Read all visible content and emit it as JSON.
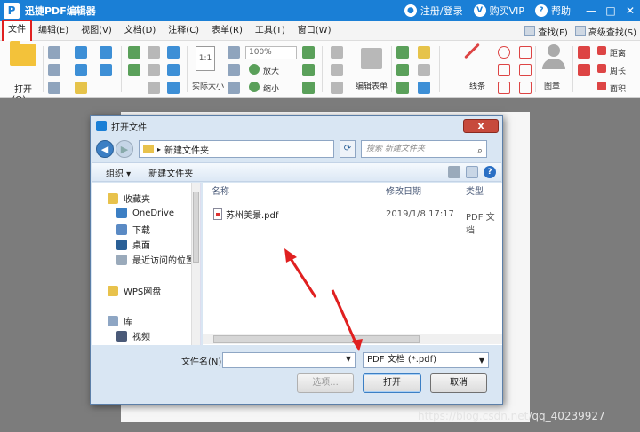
{
  "app": {
    "logo_letter": "P",
    "title": "迅捷PDF编辑器",
    "login": "注册/登录",
    "buy_vip": "购买VIP",
    "help": "帮助",
    "win_min": "—",
    "win_max": "□",
    "win_close": "✕"
  },
  "menu": {
    "items": [
      "文件",
      "编辑(E)",
      "视图(V)",
      "文档(D)",
      "注释(C)",
      "表单(R)",
      "工具(T)",
      "窗口(W)"
    ],
    "find": "查找(F)",
    "advanced_find": "高级查找(S)"
  },
  "ribbon": {
    "open_label": "打开(O)...",
    "zoom_value": "100%",
    "zoom_in": "放大",
    "zoom_out": "缩小",
    "actual_size": "实际大小",
    "actual_size_icon": "1:1",
    "edit_form": "编辑表单",
    "lines": "线条",
    "stamp": "图章",
    "distance": "距离",
    "perimeter": "周长",
    "area": "面积"
  },
  "dialog": {
    "title": "打开文件",
    "close": "x",
    "address": "新建文件夹",
    "search_placeholder": "搜索 新建文件夹",
    "organize": "组织 ▾",
    "new_folder": "新建文件夹",
    "help_icon": "?",
    "nav": [
      {
        "label": "收藏夹"
      },
      {
        "label": "OneDrive"
      },
      {
        "label": "下载"
      },
      {
        "label": "桌面"
      },
      {
        "label": "最近访问的位置"
      },
      {
        "label": "WPS网盘"
      },
      {
        "label": "库"
      },
      {
        "label": "视频"
      }
    ],
    "columns": {
      "name": "名称",
      "date": "修改日期",
      "type": "类型"
    },
    "files": [
      {
        "name": "苏州美景.pdf",
        "date": "2019/1/8 17:17",
        "type": "PDF 文档"
      }
    ],
    "filename_label": "文件名(N):",
    "filename_value": "",
    "filetype": "PDF 文档 (*.pdf)",
    "buttons": {
      "options": "选项...",
      "open": "打开",
      "cancel": "取消"
    }
  },
  "watermark": "https://blog.csdn.net/qq_40239927",
  "colors": {
    "accent": "#1a7fd6",
    "highlight": "#e02020"
  }
}
